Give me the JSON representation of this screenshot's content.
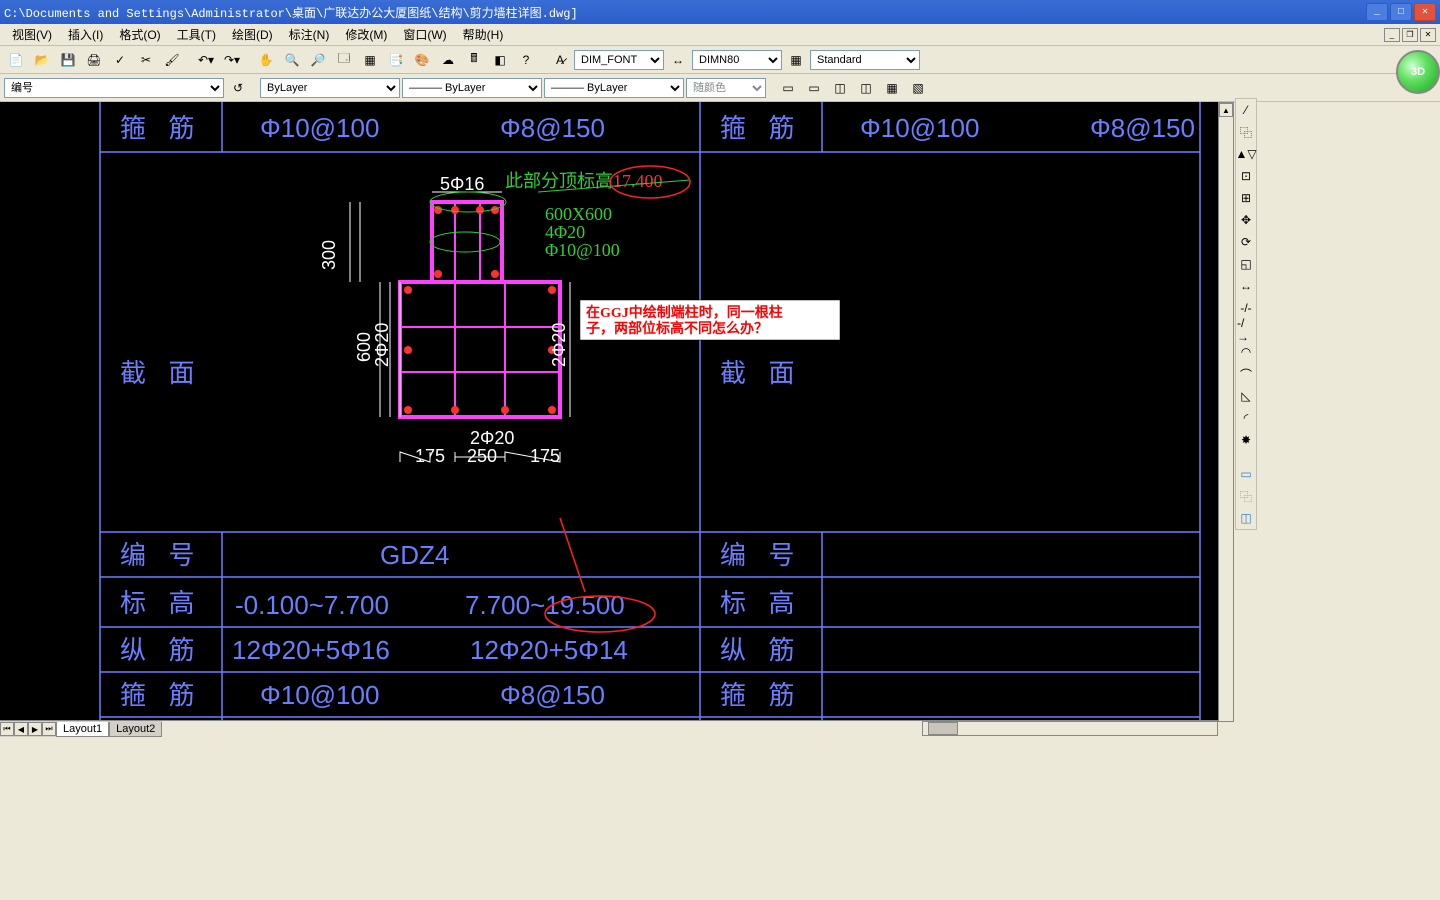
{
  "title": "C:\\Documents and Settings\\Administrator\\桌面\\广联达办公大厦图纸\\结构\\剪力墙柱详图.dwg]",
  "menu": {
    "view": "视图(V)",
    "insert": "插入(I)",
    "format": "格式(O)",
    "tools": "工具(T)",
    "draw": "绘图(D)",
    "dimension": "标注(N)",
    "modify": "修改(M)",
    "window": "窗口(W)",
    "help": "帮助(H)"
  },
  "toolbar1": {
    "font_style": "DIM_FONT",
    "dim_style": "DIMN80",
    "table_style": "Standard"
  },
  "toolbar2": {
    "layer_label": "编号",
    "linetype1": "ByLayer",
    "linetype2": "ByLayer",
    "lineweight": "ByLayer",
    "plotstyle": "随颜色"
  },
  "logo3d": "3D",
  "tabs": {
    "layout1": "Layout1",
    "layout2": "Layout2"
  },
  "table": {
    "row_stirrup": "箍  筋",
    "row_section": "截  面",
    "row_number": "编  号",
    "row_elevation": "标  高",
    "row_rebar": "纵  筋",
    "row_stirrup2": "箍  筋",
    "val_stirrup_a": "Φ10@100",
    "val_stirrup_b": "Φ8@150",
    "val_number": "GDZ4",
    "val_elev_a": "-0.100~7.700",
    "val_elev_b": "7.700~19.500",
    "val_rebar_a": "12Φ20+5Φ16",
    "val_rebar_b": "12Φ20+5Φ14",
    "val_stirrup2_a": "Φ10@100",
    "val_stirrup2_b": "Φ8@150",
    "val_right_stirrup_a": "Φ10@100",
    "val_right_stirrup_b": "Φ8@150"
  },
  "dims": {
    "top_rebar": "5Φ16",
    "h_top": "300",
    "h_bot": "600",
    "v_left": "2Φ20",
    "v_right": "2Φ20",
    "v_bot": "2Φ20",
    "w_left": "175",
    "w_mid": "250",
    "w_right": "175"
  },
  "annot": {
    "top_elev_label": "此部分顶标高",
    "top_elev_val": "17.400",
    "sec_size": "600X600",
    "sec_rb1": "4Φ20",
    "sec_rb2": "Φ10@100"
  },
  "note": {
    "line1": "在GGJ中绘制端柱时，同一根柱",
    "line2": "子，两部位标高不同怎么办？"
  }
}
